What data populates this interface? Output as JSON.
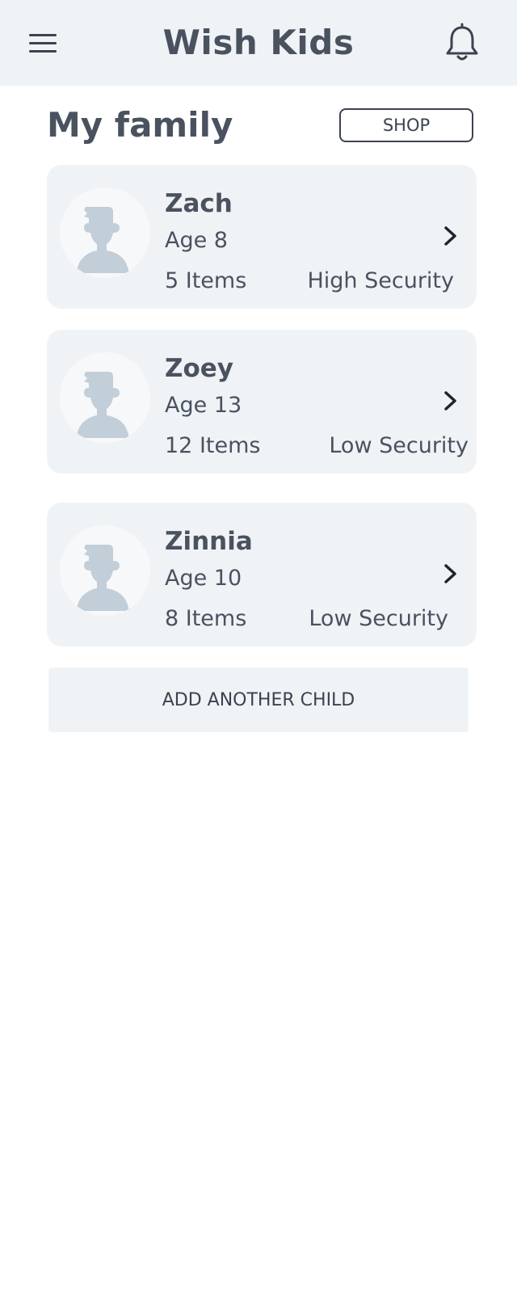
{
  "header": {
    "title": "Wish Kids",
    "menu_icon": "hamburger-menu-icon",
    "notification_icon": "bell-icon"
  },
  "section": {
    "title": "My family",
    "shop_label": "SHOP"
  },
  "children": [
    {
      "name": "Zach",
      "age": "Age 8",
      "items": "5 Items",
      "security": "High Security"
    },
    {
      "name": "Zoey",
      "age": "Age 13",
      "items": "12 Items",
      "security": "Low Security"
    },
    {
      "name": "Zinnia",
      "age": "Age 10",
      "items": "8 Items",
      "security": "Low Security"
    }
  ],
  "add_child_label": "ADD ANOTHER CHILD",
  "colors": {
    "header_bg": "#f0f3f6",
    "card_bg": "#f0f3f6",
    "text": "#4a5260",
    "avatar_silhouette": "#c2ced8"
  }
}
